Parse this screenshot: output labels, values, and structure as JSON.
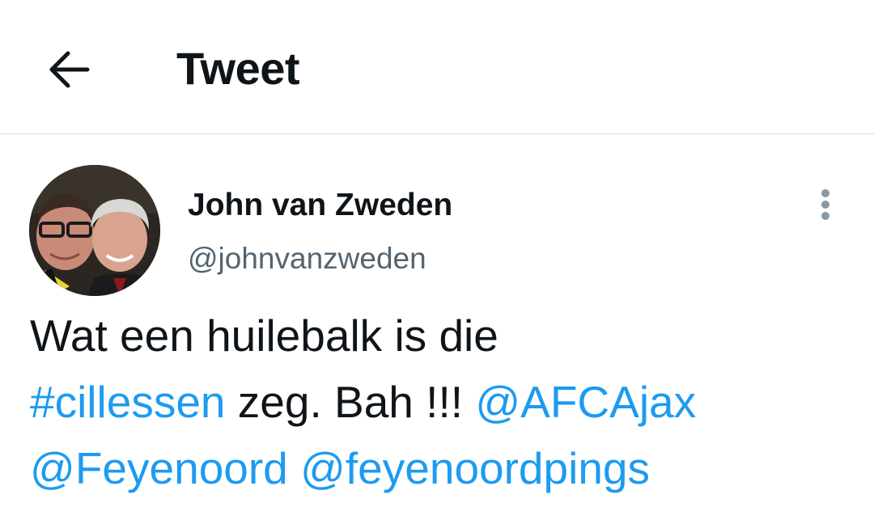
{
  "header": {
    "back_icon": "arrow-left-icon",
    "title": "Tweet"
  },
  "author": {
    "avatar": "profile-photo",
    "display_name": "John van Zweden",
    "handle": "@johnvanzweden"
  },
  "more_icon": "more-vertical-icon",
  "tweet": {
    "line1": "Wat een huilebalk is die",
    "hashtag": "#cillessen",
    "line2_text": " zeg. Bah !!! ",
    "mention1": "@AFCAjax",
    "mention2": "@Feyenoord",
    "line3_space": " ",
    "mention3": "@feyenoordpings"
  },
  "colors": {
    "link": "#1d9bf0",
    "text": "#0f1419",
    "secondary": "#536471",
    "divider": "#cfd9de"
  }
}
